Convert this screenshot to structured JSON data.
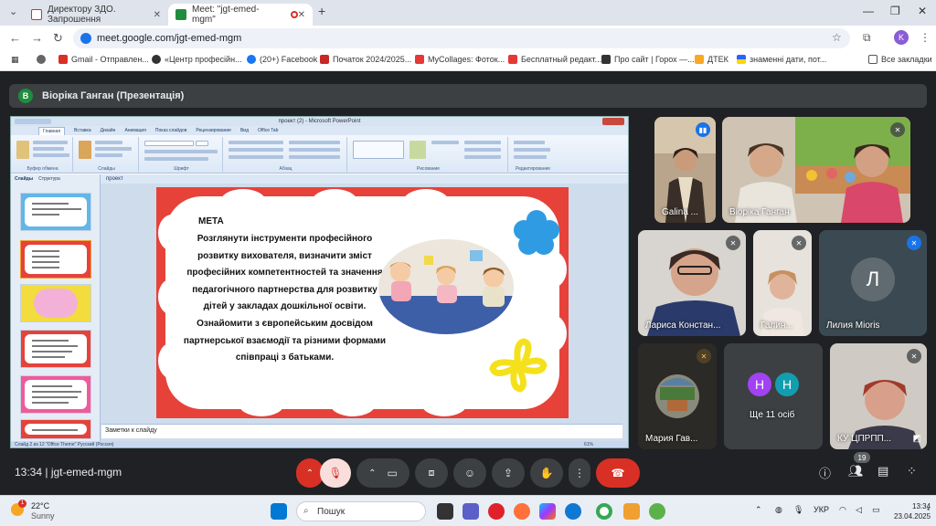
{
  "browser": {
    "tabs": [
      {
        "title": "Директору ЗДО. Запрошення",
        "favicon_color": "#d93025"
      },
      {
        "title": "Meet: \"jgt-emed-mgm\"",
        "favicon_color": "#1e8e3e"
      }
    ],
    "new_tab": "+",
    "url": "meet.google.com/jgt-emed-mgm",
    "profile_initial": "K",
    "bookmarks": [
      "Gmail - Отправлен...",
      "«Центр професійн...",
      "(20+) Facebook",
      "Початок 2024/2025...",
      "MyCollages: Фоток...",
      "Бесплатный редакт...",
      "Про сайт | Горох —...",
      "ДТЕК",
      "знаменні дати, пот..."
    ],
    "all_bookmarks": "Все закладки"
  },
  "meet": {
    "presenter_initial": "В",
    "presenter_label": "Віоріка Ганган (Презентація)",
    "time": "13:34",
    "meeting_code": "jgt-emed-mgm",
    "participants_count": "19"
  },
  "ppt": {
    "window_title": "проект (2) - Microsoft PowerPoint",
    "ribbon_tabs": [
      "Главная",
      "Вставка",
      "Дизайн",
      "Анимация",
      "Показ слайдов",
      "Рецензирование",
      "Вид",
      "Office Tab"
    ],
    "ribbon_groups": [
      "Буфер обмена",
      "Слайды",
      "Шрифт",
      "Абзац",
      "Рисование",
      "Редактирование"
    ],
    "doc_tabs": [
      "проект",
      "проект (2)"
    ],
    "pane_tabs": [
      "Слайды",
      "Структура"
    ],
    "doc_tab": "проект",
    "notes_placeholder": "Заметки к слайду",
    "status": "Слайд 2 из 12    \"Office Theme\"    Русский (Россия)",
    "zoom": "61%"
  },
  "slide": {
    "heading": "МЕТА",
    "body": "Розглянути інструменти професійного розвитку вихователя, визначити зміст професійних компетентностей та значення педагогічного партнерства для розвитку дітей у закладах дошкільної освіти. Ознайомити з європейським досвідом партнерської взаємодії та різними формами співпраці з батьками.",
    "frame_color": "#e6423a",
    "blue_flower": "#2f9be3",
    "yellow_flower": "#f4e11c"
  },
  "participants": [
    {
      "name": "Galina ...",
      "speaking": true
    },
    {
      "name": "Віоріка Ганган",
      "speaking": false
    },
    {
      "name": "Лариса Констан...",
      "muted": true
    },
    {
      "name": "Галин...",
      "muted": true
    },
    {
      "name": "Лилия Mioris",
      "initial": "Л",
      "muted": true
    },
    {
      "name": "Мария Гав...",
      "muted": true
    },
    {
      "name": "Ще 11 осіб",
      "avatars": [
        "Н",
        "Н"
      ]
    },
    {
      "name": "КУ ЦПРПП...",
      "muted": true
    }
  ],
  "taskbar": {
    "weather_temp": "22°C",
    "weather_desc": "Sunny",
    "weather_badge": "1",
    "search": "Пошук",
    "lang": "УКР",
    "time": "13:34",
    "date": "23.04.2025"
  }
}
